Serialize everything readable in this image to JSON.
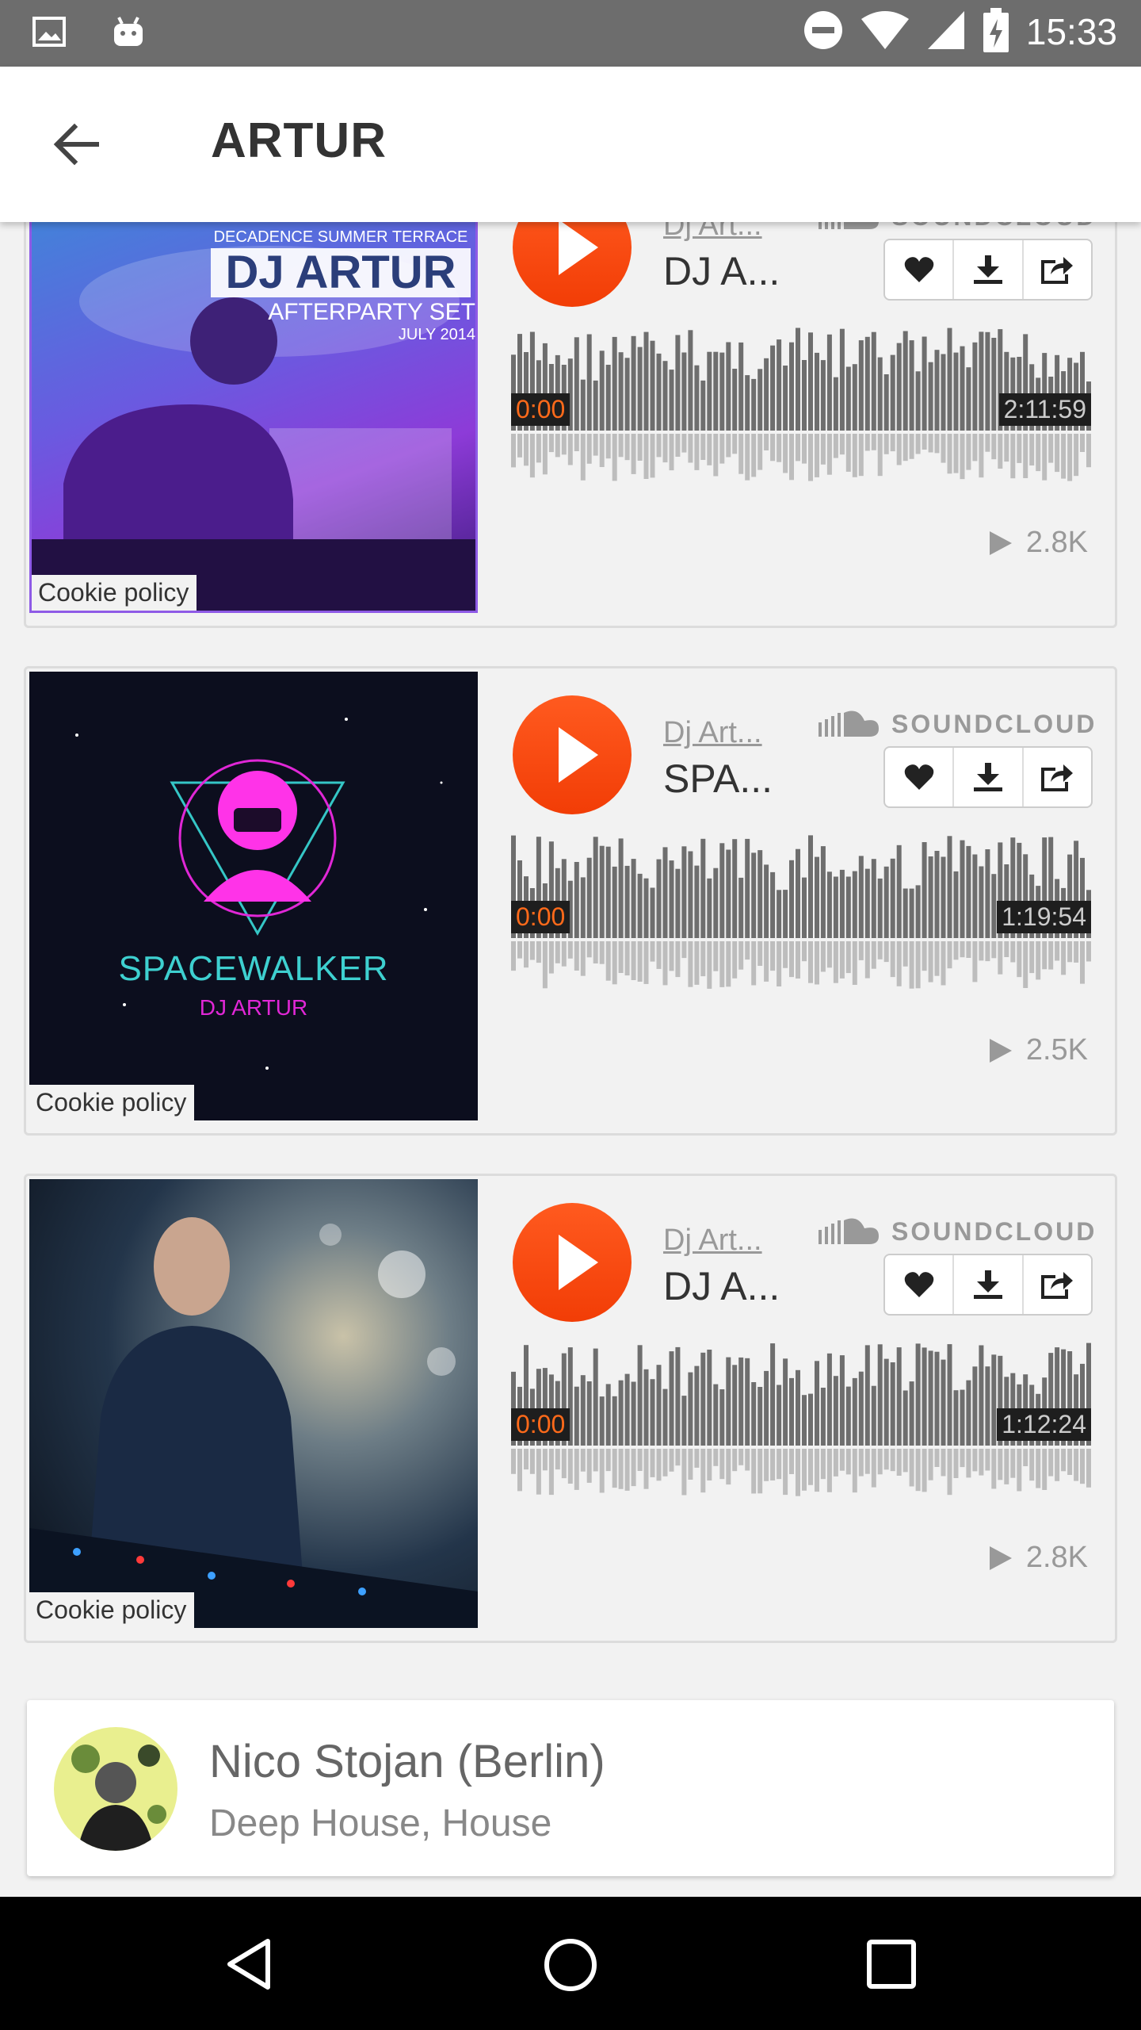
{
  "status_bar": {
    "time": "15:33"
  },
  "app_bar": {
    "title": "ARTUR"
  },
  "cards": [
    {
      "artist": "Dj Art...",
      "track": "DJ A...",
      "duration": "2:11:59",
      "start": "0:00",
      "plays": "2.8K",
      "cookie": "Cookie policy",
      "cover": {
        "top_line": "DECADENCE SUMMER TERRACE",
        "title": "DJ ARTUR",
        "subtitle": "AFTERPARTY SET",
        "date": "JULY 2014"
      }
    },
    {
      "artist": "Dj Art...",
      "track": "SPA...",
      "duration": "1:19:54",
      "start": "0:00",
      "plays": "2.5K",
      "cookie": "Cookie policy",
      "cover": {
        "title": "SPACEWALKER",
        "subtitle": "DJ ARTUR"
      }
    },
    {
      "artist": "Dj Art...",
      "track": "DJ A...",
      "duration": "1:12:24",
      "start": "0:00",
      "plays": "2.8K",
      "cookie": "Cookie policy"
    }
  ],
  "soundcloud_label": "SOUNDCLOUD",
  "artist_row": {
    "name": "Nico Stojan (Berlin)",
    "genres": "Deep House, House"
  },
  "icons": [
    "image-icon",
    "android-icon",
    "do-not-disturb-icon",
    "wifi-icon",
    "signal-icon",
    "battery-icon",
    "back-arrow-icon",
    "play-icon",
    "soundcloud-icon",
    "heart-icon",
    "download-icon",
    "share-icon",
    "play-count-icon",
    "nav-back-icon",
    "nav-home-icon",
    "nav-recents-icon"
  ],
  "colors": {
    "accent": "#f23d06",
    "status_bar": "#6d6d6d"
  }
}
